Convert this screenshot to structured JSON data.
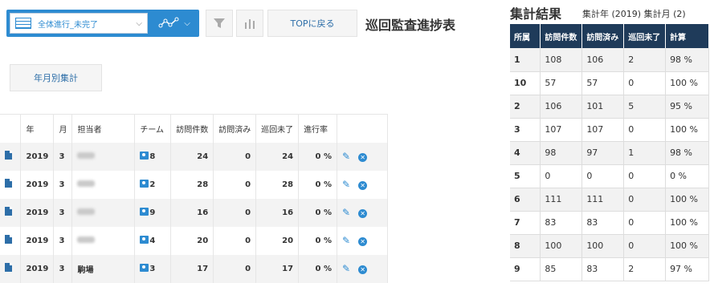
{
  "toolbar": {
    "view_label": "全体進行_未完了",
    "top_button": "TOPに戻る",
    "title": "巡回監査進捗表",
    "monthly_button": "年月別集計"
  },
  "grid": {
    "headers": [
      "年",
      "月",
      "担当者",
      "チーム",
      "訪問件数",
      "訪問済み",
      "巡回未了",
      "進行率"
    ],
    "rows": [
      {
        "year": "2019",
        "month": "3",
        "person": "",
        "team": "8",
        "visits": "24",
        "done": "0",
        "remaining": "24",
        "rate": "0 %"
      },
      {
        "year": "2019",
        "month": "3",
        "person": "",
        "team": "2",
        "visits": "28",
        "done": "0",
        "remaining": "28",
        "rate": "0 %"
      },
      {
        "year": "2019",
        "month": "3",
        "person": "",
        "team": "9",
        "visits": "16",
        "done": "0",
        "remaining": "16",
        "rate": "0 %"
      },
      {
        "year": "2019",
        "month": "3",
        "person": "",
        "team": "4",
        "visits": "20",
        "done": "0",
        "remaining": "20",
        "rate": "0 %"
      },
      {
        "year": "2019",
        "month": "3",
        "person": "駒場",
        "team": "3",
        "visits": "17",
        "done": "0",
        "remaining": "17",
        "rate": "0 %"
      }
    ]
  },
  "summary": {
    "title": "集計結果",
    "subtitle": "集計年 (2019) 集計月 (2)",
    "headers": [
      "所属",
      "訪問件数",
      "訪問済み",
      "巡回未了",
      "計算"
    ],
    "rows": [
      [
        "1",
        "108",
        "106",
        "2",
        "98 %"
      ],
      [
        "10",
        "57",
        "57",
        "0",
        "100 %"
      ],
      [
        "2",
        "106",
        "101",
        "5",
        "95 %"
      ],
      [
        "3",
        "107",
        "107",
        "0",
        "100 %"
      ],
      [
        "4",
        "98",
        "97",
        "1",
        "98 %"
      ],
      [
        "5",
        "0",
        "0",
        "0",
        "0 %"
      ],
      [
        "6",
        "111",
        "111",
        "0",
        "100 %"
      ],
      [
        "7",
        "83",
        "83",
        "0",
        "100 %"
      ],
      [
        "8",
        "100",
        "100",
        "0",
        "100 %"
      ],
      [
        "9",
        "85",
        "83",
        "2",
        "97 %"
      ]
    ]
  }
}
